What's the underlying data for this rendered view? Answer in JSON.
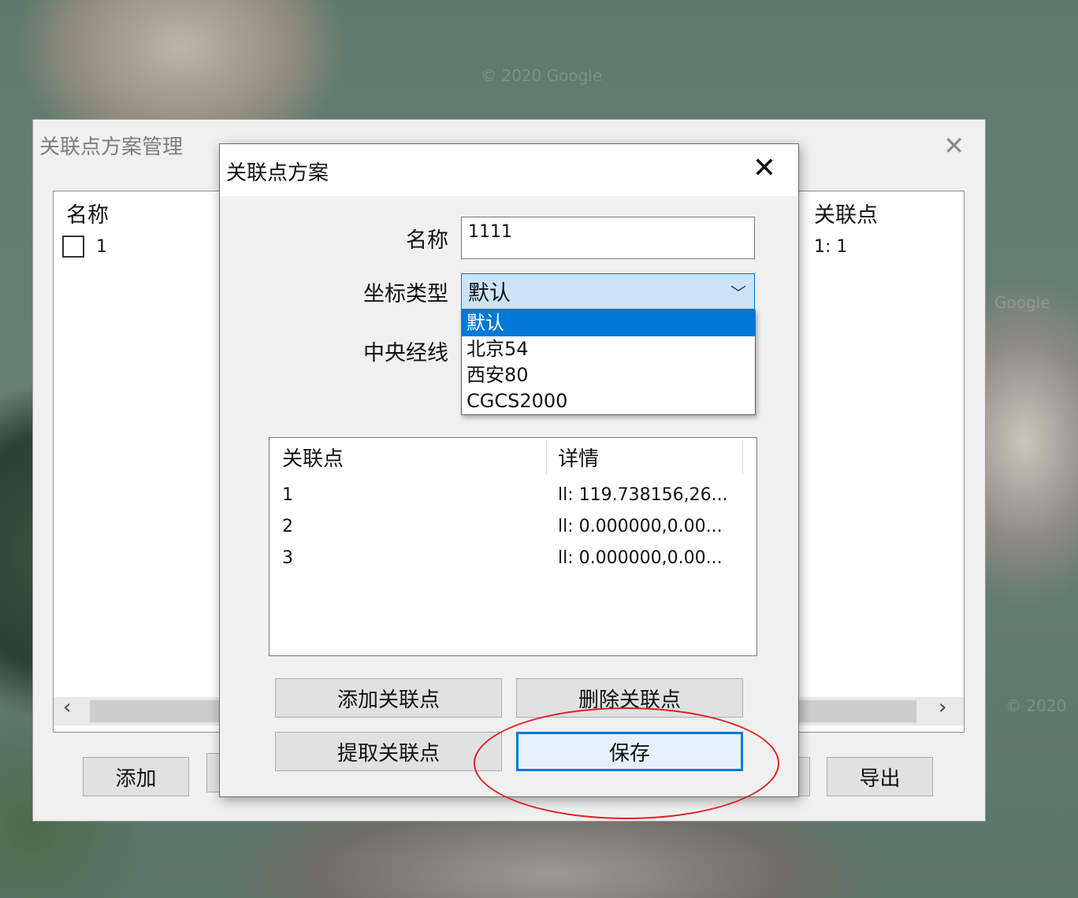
{
  "background": {
    "watermarks": [
      "© 2020 Google",
      "Google",
      "© 2020"
    ]
  },
  "manager": {
    "title": "关联点方案管理",
    "left_column_header": "名称",
    "rows": [
      {
        "name": "1"
      }
    ],
    "right_column_header": "关联点",
    "right_rows": [
      "1: 1"
    ],
    "buttons": {
      "add": "添加",
      "export": "导出"
    }
  },
  "dialog": {
    "title": "关联点方案",
    "fields": {
      "name_label": "名称",
      "name_value": "1111",
      "coord_label": "坐标类型",
      "coord_value": "默认",
      "meridian_label": "中央经线"
    },
    "coord_options": [
      "默认",
      "北京54",
      "西安80",
      "CGCS2000"
    ],
    "coord_selected_index": 0,
    "table": {
      "headers": [
        "关联点",
        "详情"
      ],
      "rows": [
        {
          "point": "1",
          "detail": "ll: 119.738156,26..."
        },
        {
          "point": "2",
          "detail": "ll: 0.000000,0.00..."
        },
        {
          "point": "3",
          "detail": "ll: 0.000000,0.00..."
        }
      ]
    },
    "buttons": {
      "add_point": "添加关联点",
      "delete_point": "删除关联点",
      "extract_point": "提取关联点",
      "save": "保存"
    }
  },
  "colors": {
    "highlight": "#0078d7",
    "annotation_circle": "#dd2222"
  }
}
